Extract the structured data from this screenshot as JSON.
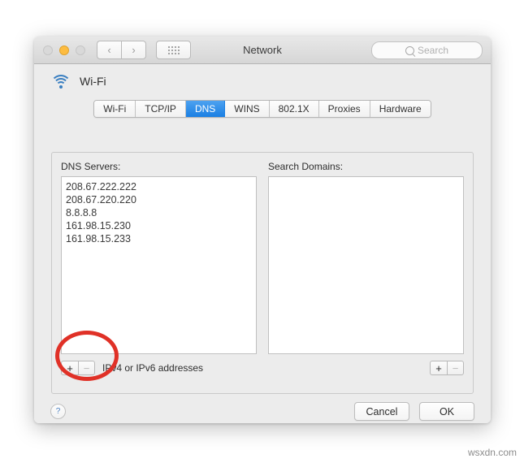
{
  "window": {
    "title": "Network",
    "traffic_lights": [
      "close",
      "minimize",
      "zoom"
    ],
    "nav": {
      "back": "‹",
      "forward": "›"
    },
    "grid_button": "show-all-grid",
    "search": {
      "placeholder": "Search",
      "value": ""
    }
  },
  "service": {
    "icon": "wifi-icon",
    "name": "Wi-Fi"
  },
  "tabs": [
    {
      "label": "Wi-Fi",
      "selected": false
    },
    {
      "label": "TCP/IP",
      "selected": false
    },
    {
      "label": "DNS",
      "selected": true
    },
    {
      "label": "WINS",
      "selected": false
    },
    {
      "label": "802.1X",
      "selected": false
    },
    {
      "label": "Proxies",
      "selected": false
    },
    {
      "label": "Hardware",
      "selected": false
    }
  ],
  "dns_servers": {
    "label": "DNS Servers:",
    "items": [
      "208.67.222.222",
      "208.67.220.220",
      "8.8.8.8",
      "161.98.15.230",
      "161.98.15.233"
    ],
    "add_label": "+",
    "remove_label": "−",
    "hint": "IPv4 or IPv6 addresses"
  },
  "search_domains": {
    "label": "Search Domains:",
    "items": [],
    "add_label": "+",
    "remove_label": "−"
  },
  "footer": {
    "help_label": "?",
    "cancel_label": "Cancel",
    "ok_label": "OK"
  },
  "annotation": {
    "shape": "ellipse",
    "color": "#e03127",
    "target": "dns-add-remove-buttons"
  },
  "watermark": "wsxdn.com",
  "colors": {
    "accent_selected_tab": "#1a7fe3",
    "wifi_icon": "#3a7fc1",
    "annotation": "#e03127",
    "window_bg": "#ececec"
  }
}
